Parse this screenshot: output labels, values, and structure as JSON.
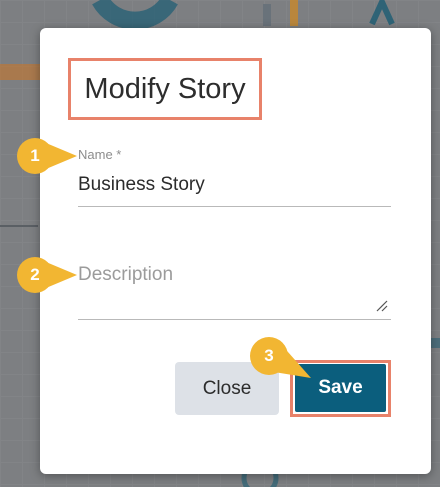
{
  "dialog": {
    "title": "Modify Story",
    "name_label": "Name *",
    "name_value": "Business Story",
    "description_placeholder": "Description",
    "close_label": "Close",
    "save_label": "Save"
  },
  "callouts": [
    "1",
    "2",
    "3"
  ],
  "colors": {
    "highlight": "#e8826a",
    "callout": "#f2b632",
    "primary": "#0b5e7d",
    "secondary": "#dde1e7"
  }
}
